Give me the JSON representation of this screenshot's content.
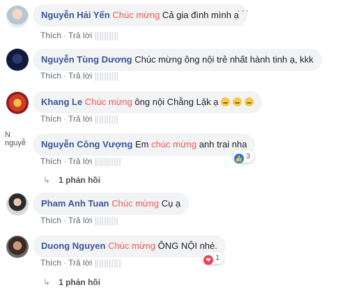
{
  "comments": [
    {
      "name": "Nguyễn Hải Yến",
      "highlight": "Chúc mừng",
      "text_after": " Cả gia đình mình ạ",
      "text_before": ""
    },
    {
      "name": "Nguyễn Tùng Dương",
      "highlight": "",
      "text_before": "Chúc mừng ông nội trẻ nhất hành tinh ạ, kkk",
      "text_after": ""
    },
    {
      "name": "Khang Le",
      "highlight": "Chúc mừng",
      "text_before": "",
      "text_after": " ông nội Chằng Lặk ạ"
    },
    {
      "name": "Nguyễn Công Vượng",
      "highlight": "chúc mừng",
      "text_before": "Em ",
      "text_after": " anh trai nha",
      "avatar_alt": "N nguyễ",
      "reaction_count": "3",
      "replies": "1 phản hồi"
    },
    {
      "name": "Pham Anh Tuan",
      "highlight": "Chúc mừng",
      "text_before": "",
      "text_after": " Cụ ạ"
    },
    {
      "name": "Duong Nguyen",
      "highlight": "Chúc mừng",
      "text_before": "",
      "text_after": " ÔNG NỘI nhé.",
      "reaction_count": "1",
      "replies": "1 phản hồi"
    }
  ],
  "actions": {
    "like": "Thích",
    "reply": "Trả lời",
    "more": "···"
  },
  "icons": {
    "like": "like-icon",
    "love": "heart-icon",
    "emoji": "laughing-emoji-icon",
    "reply_arrow": "reply-arrow-icon"
  },
  "colors": {
    "name": "#385898",
    "highlight": "#f0584f",
    "bubble": "#f2f3f5",
    "like": "#1877f2",
    "love": "#f33e58"
  }
}
